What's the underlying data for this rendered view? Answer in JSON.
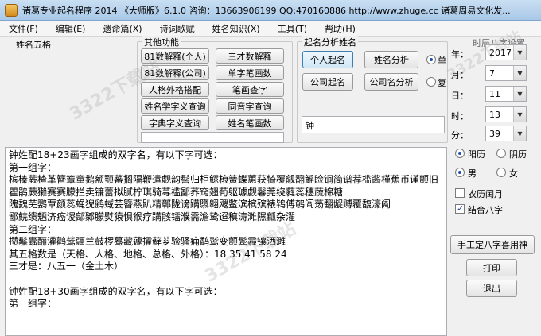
{
  "window": {
    "title": "诸葛专业起名程序  2014  《大师版》6.1.0    咨询：13663906199 QQ:470160886  http://www.zhuge.cc    诸葛周易文化发..."
  },
  "menu": [
    {
      "label": "文件(F)"
    },
    {
      "label": "编辑(E)"
    },
    {
      "label": "遗命篇(X)"
    },
    {
      "label": "诗词歌赋"
    },
    {
      "label": "姓名知识(X)"
    },
    {
      "label": "工具(T)"
    },
    {
      "label": "帮助(H)"
    }
  ],
  "panels": {
    "wuge_label": "姓名五格",
    "other_label": "其他功能",
    "analysis_label": "起名分析姓名",
    "datetime_label": "时辰八字设置"
  },
  "other_buttons": [
    {
      "label": "81数解释(个人)"
    },
    {
      "label": "三才数解释"
    },
    {
      "label": "81数解释(公司)"
    },
    {
      "label": "单字笔画数"
    },
    {
      "label": "人格外格搭配"
    },
    {
      "label": "笔画查字"
    },
    {
      "label": "姓名学字义查询"
    },
    {
      "label": "同音字查询"
    },
    {
      "label": "字典字义查询"
    },
    {
      "label": "姓名笔画数"
    }
  ],
  "analysis": {
    "personal_name": "个人起名",
    "name_analysis": "姓名分析",
    "company_name": "公司起名",
    "company_analysis": "公司名分析",
    "single_label": "单",
    "double_label": "复",
    "surname": "钟"
  },
  "datetime": {
    "year_label": "年：",
    "year_value": "2017",
    "month_label": "月：",
    "month_value": "7",
    "day_label": "日：",
    "day_value": "11",
    "hour_label": "时：",
    "hour_value": "13",
    "minute_label": "分：",
    "minute_value": "39",
    "solar_label": "阳历",
    "lunar_label": "阴历",
    "male_label": "男",
    "female_label": "女",
    "leap_label": "农历闰月",
    "bazi_label": "结合八字"
  },
  "actions": {
    "manual_bazi": "手工定八字喜用神",
    "print": "打印",
    "exit": "退出"
  },
  "watermark": "3322下载站",
  "results": {
    "line1": "钟姓配18+23画字组成的双字名，有以下字可选：",
    "line2": "第一组字：",
    "line3": "槟榛蕨楂革簪簟童鹅额颚蕃搁隔鞭遣觑韵髻归柜鳏榱簧蝶蕙获犄覆觎翻鳐睑锏简谱荐槛酱槿蕉币谨颤旧瞿鹃蕨獭赛赛朦拦卖镰蕾拟腻柠琪骑荨褴鄙荞窍翘荀躯璩觑鬈莞绕蕤蕊穗蔬棉糖",
    "line4": "隗魏芜鹦覃颜蕊蝇猊鹞蜮芸簪燕趴精鄣陇谤蹒隳翱飕鳖滨槟殡裱鸨傅鹌阎荡翻龊赙覆馥濠阖",
    "line5": "鄙鲩缋魉济癌谡鄗鄹朦熨猿惧猴疗蹒骸镭濮需澹鸷迢稹涛濉隰瓤杂濯",
    "line6": "第二组字：",
    "line7": "攒鬈蠹酾灌鹳鸶疆兰鼓椤蓦藏蘧攉藓芗验骚痈鹬鹫变颤鬓霾镶洒濉",
    "line8": "其五格数是（天格、人格、地格、总格、外格）：18 35 41 58 24",
    "line9": "三才是：八五一（金土木）",
    "line10": "",
    "line11": "钟姓配18+30画字组成的双字名，有以下字可选：",
    "line12": "第一组字："
  }
}
